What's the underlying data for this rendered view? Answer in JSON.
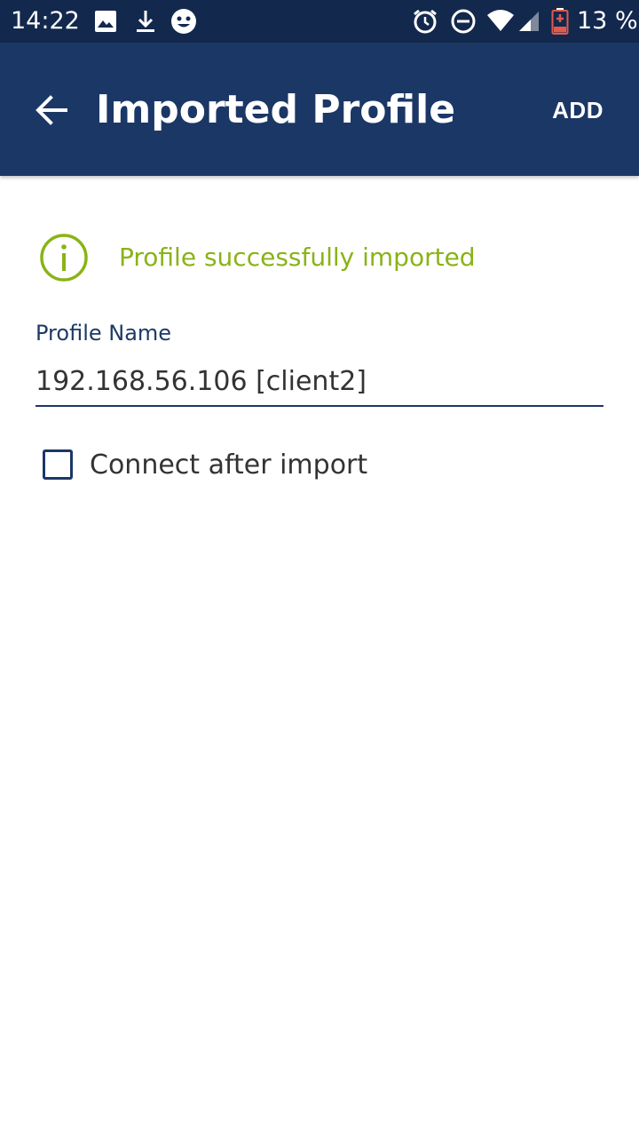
{
  "status_bar": {
    "time": "14:22",
    "icons_left": [
      "image-icon",
      "download-icon",
      "face-icon"
    ],
    "icons_right": [
      "alarm-icon",
      "do-not-disturb-icon",
      "wifi-icon",
      "cell-signal-icon",
      "battery-low-icon"
    ],
    "battery_text": "13 %"
  },
  "app_bar": {
    "back_icon": "arrow-left-icon",
    "title": "Imported Profile",
    "add_label": "ADD"
  },
  "notice": {
    "icon": "info-icon",
    "text": "Profile successfully imported"
  },
  "profile_name": {
    "label": "Profile Name",
    "value": "192.168.56.106 [client2]"
  },
  "connect_after_import": {
    "label": "Connect after import",
    "checked": false
  },
  "colors": {
    "status_bar": "#13284d",
    "app_bar": "#1b3766",
    "success": "#8ab317",
    "label": "#1e3a66",
    "battery_warning": "#e05a4e"
  }
}
